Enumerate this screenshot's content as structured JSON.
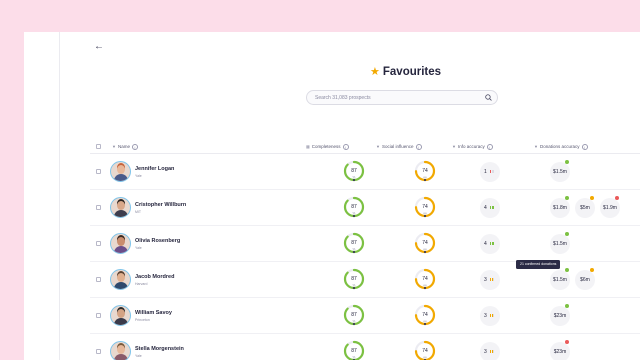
{
  "title": "Favourites",
  "search": {
    "placeholder": "Search 31,083 prospects"
  },
  "columns": {
    "name": "Name",
    "completeness": "Completeness",
    "social": "Social influence",
    "info": "Info accuracy",
    "donations": "Donations accuracy"
  },
  "colors": {
    "green": "#7cc142",
    "orange": "#f2a900",
    "red": "#ea5a5a",
    "avatar_ring": "#7fc4ea"
  },
  "rows": [
    {
      "name": "Jennifer Logan",
      "org": "Yale",
      "completeness": 87,
      "social": 74,
      "info": "1",
      "info_level": "low",
      "donations": [
        {
          "value": "$1.5m",
          "dot": "green"
        }
      ]
    },
    {
      "name": "Cristopher Willburn",
      "org": "MIT",
      "completeness": 87,
      "social": 74,
      "info": "4",
      "info_level": "high",
      "donations": [
        {
          "value": "$1.8m",
          "dot": "green"
        },
        {
          "value": "$5m",
          "dot": "orange"
        },
        {
          "value": "$1.9m",
          "dot": "red"
        }
      ]
    },
    {
      "name": "Olivia Rosenberg",
      "org": "Yale",
      "completeness": 87,
      "social": 74,
      "info": "4",
      "info_level": "high",
      "donations": [
        {
          "value": "$1.5m",
          "dot": "green"
        }
      ]
    },
    {
      "name": "Jacob Mordred",
      "org": "Harvard",
      "completeness": 87,
      "social": 74,
      "info": "3",
      "info_level": "mid",
      "donations": [
        {
          "value": "$1.5m",
          "dot": "green"
        },
        {
          "value": "$6m",
          "dot": "orange"
        }
      ]
    },
    {
      "name": "William Savoy",
      "org": "Princeton",
      "completeness": 87,
      "social": 74,
      "info": "3",
      "info_level": "mid",
      "donations": [
        {
          "value": "$23m",
          "dot": "green"
        }
      ]
    },
    {
      "name": "Stella Morgenstein",
      "org": "Yale",
      "completeness": 87,
      "social": 74,
      "info": "3",
      "info_level": "mid",
      "donations": [
        {
          "value": "$23m",
          "dot": "red"
        }
      ]
    }
  ],
  "tooltip": "21 confirmed donations"
}
